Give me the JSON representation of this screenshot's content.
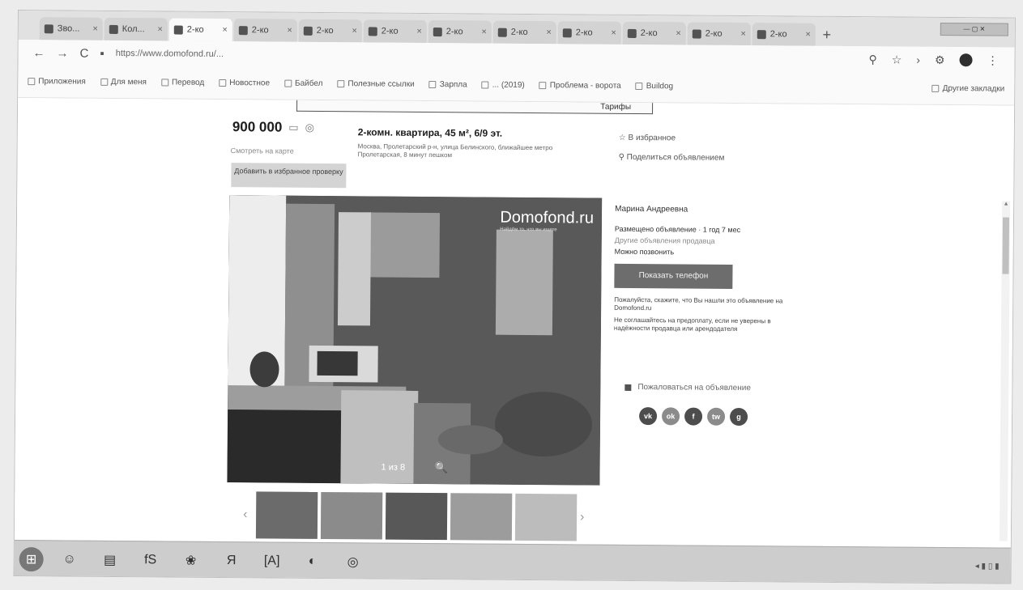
{
  "browser": {
    "tabs": [
      {
        "label": "Зво..."
      },
      {
        "label": "Кол..."
      },
      {
        "label": "2-ко"
      },
      {
        "label": "2-ко"
      },
      {
        "label": "2-ко"
      },
      {
        "label": "2-ко"
      },
      {
        "label": "2-ко"
      },
      {
        "label": "2-ко"
      },
      {
        "label": "2-ко"
      },
      {
        "label": "2-ко"
      },
      {
        "label": "2-ко"
      },
      {
        "label": "2-ко"
      }
    ],
    "tab_close": "×",
    "new_tab": "+",
    "window_controls": "— ▢ ✕",
    "url": "https://www.domofond.ru/...",
    "nav_back": "←",
    "nav_forward": "→",
    "nav_reload": "C",
    "lock": "▪"
  },
  "bookmarks": {
    "items": [
      {
        "label": "Приложения"
      },
      {
        "label": "Для меня"
      },
      {
        "label": "Перевод"
      },
      {
        "label": "Новостное"
      },
      {
        "label": "Байбел"
      },
      {
        "label": "Полезные ссылки"
      },
      {
        "label": "Зарпла"
      },
      {
        "label": "... (2019)"
      },
      {
        "label": "Проблема - ворота"
      },
      {
        "label": "Buildog"
      }
    ],
    "other": "Другие закладки"
  },
  "listing": {
    "banner": "Тарифы",
    "price": "900 000",
    "price_icon_1": "▭",
    "price_icon_2": "◎",
    "permalink": "Смотреть на карте",
    "request_button": "Добавить в избранное проверку",
    "title": "2-комн. квартира, 45 м², 6/9 эт.",
    "address": "Москва, Пролетарский р-н, улица Белинского, ближайшее метро Пролетарская, 8 минут пешком",
    "favorite": "☆ В избранное",
    "share": "⚲ Поделиться объявлением"
  },
  "photo": {
    "watermark": "Domofond.ru",
    "watermark_tagline": "Найдём то, что вы ищете",
    "counter": "1 из 8",
    "zoom_icon": "🔍"
  },
  "thumbnails": {
    "prev": "‹",
    "next": "›",
    "count": 5
  },
  "seller": {
    "name": "Марина Андреевна",
    "posted": "Размещено объявление · 1 год 7 мес",
    "other_ads": "Другие объявления продавца",
    "phone_label": "Можно позвонить",
    "contact_button": "Показать телефон",
    "note_1": "Пожалуйста, скажите, что Вы нашли это объявление на Domofond.ru",
    "note_2": "Не соглашайтесь на предоплату, если не уверены в надёжности продавца или арендодателя"
  },
  "report": {
    "label": "Пожаловаться на объявление"
  },
  "socials": [
    {
      "label": "vk"
    },
    {
      "label": "ok"
    },
    {
      "label": "f"
    },
    {
      "label": "tw"
    },
    {
      "label": "g"
    }
  ],
  "taskbar": {
    "items": [
      {
        "label": "⊞"
      },
      {
        "label": "☺"
      },
      {
        "label": "▤"
      },
      {
        "label": "fS"
      },
      {
        "label": "❀"
      },
      {
        "label": "Я"
      },
      {
        "label": "[A]"
      },
      {
        "label": "◐"
      },
      {
        "label": "◎"
      }
    ],
    "tray": "◂ ▮ ▯ ▮"
  },
  "colors": {
    "accent": "#6e6e6e",
    "page_bg": "#fbfbfb"
  }
}
